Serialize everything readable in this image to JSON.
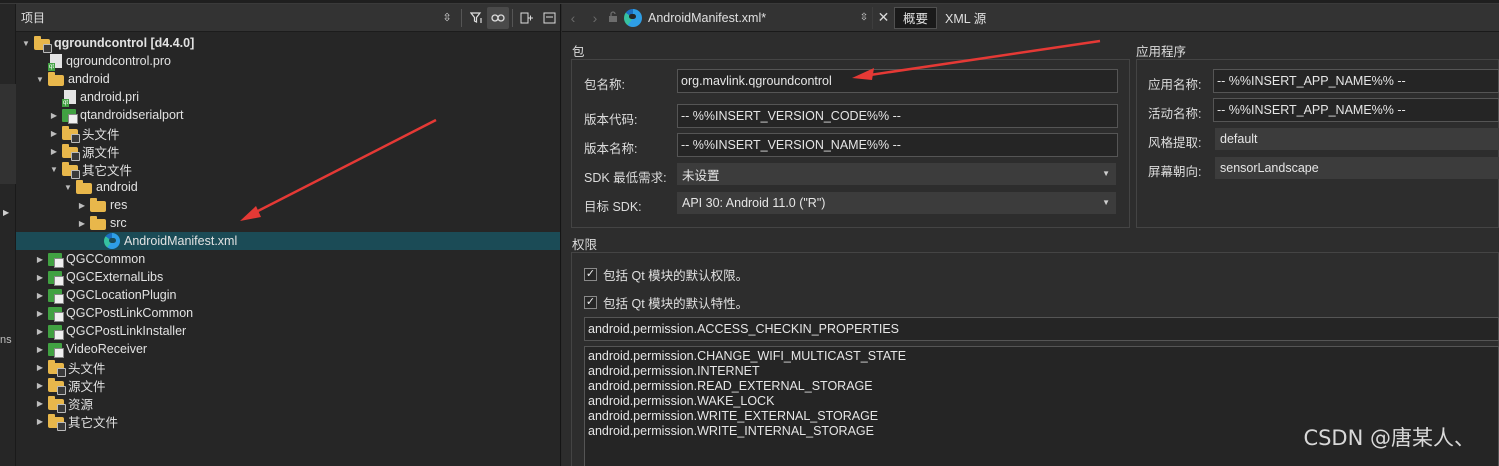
{
  "project_panel": {
    "title": "项目",
    "tree": [
      {
        "label": "qgroundcontrol [d4.4.0]",
        "bold": true,
        "indent": 0,
        "twisty": "open",
        "icon": "qt-project-root-icon"
      },
      {
        "label": "qgroundcontrol.pro",
        "indent": 1,
        "twisty": "",
        "icon": "pro-file-icon"
      },
      {
        "label": "android",
        "indent": 1,
        "twisty": "open",
        "icon": "folder-icon"
      },
      {
        "label": "android.pri",
        "indent": 2,
        "twisty": "",
        "icon": "pri-file-icon"
      },
      {
        "label": "qtandroidserialport",
        "indent": 2,
        "twisty": "closed",
        "icon": "qt-project-icon"
      },
      {
        "label": "头文件",
        "indent": 2,
        "twisty": "closed",
        "icon": "header-folder-icon"
      },
      {
        "label": "源文件",
        "indent": 2,
        "twisty": "closed",
        "icon": "source-folder-icon"
      },
      {
        "label": "其它文件",
        "indent": 2,
        "twisty": "open",
        "icon": "other-files-folder-icon"
      },
      {
        "label": "android",
        "indent": 3,
        "twisty": "open",
        "icon": "folder-icon"
      },
      {
        "label": "res",
        "indent": 4,
        "twisty": "closed",
        "icon": "folder-icon"
      },
      {
        "label": "src",
        "indent": 4,
        "twisty": "closed",
        "icon": "folder-icon"
      },
      {
        "label": "AndroidManifest.xml",
        "indent": 5,
        "twisty": "",
        "icon": "edge-browser-icon",
        "selected": true
      },
      {
        "label": "QGCCommon",
        "indent": 1,
        "twisty": "closed",
        "icon": "qt-project-icon"
      },
      {
        "label": "QGCExternalLibs",
        "indent": 1,
        "twisty": "closed",
        "icon": "qt-project-icon"
      },
      {
        "label": "QGCLocationPlugin",
        "indent": 1,
        "twisty": "closed",
        "icon": "qt-project-icon"
      },
      {
        "label": "QGCPostLinkCommon",
        "indent": 1,
        "twisty": "closed",
        "icon": "qt-project-icon"
      },
      {
        "label": "QGCPostLinkInstaller",
        "indent": 1,
        "twisty": "closed",
        "icon": "qt-project-icon"
      },
      {
        "label": "VideoReceiver",
        "indent": 1,
        "twisty": "closed",
        "icon": "qt-project-icon"
      },
      {
        "label": "头文件",
        "indent": 1,
        "twisty": "closed",
        "icon": "header-folder-icon"
      },
      {
        "label": "源文件",
        "indent": 1,
        "twisty": "closed",
        "icon": "source-folder-icon"
      },
      {
        "label": "资源",
        "indent": 1,
        "twisty": "closed",
        "icon": "resource-folder-icon"
      },
      {
        "label": "其它文件",
        "indent": 1,
        "twisty": "closed",
        "icon": "other-files-folder-icon"
      }
    ]
  },
  "left_strip": {
    "ns_text": "ns"
  },
  "editor": {
    "document_name": "AndroidManifest.xml*",
    "tabs": [
      {
        "label": "概要",
        "active": true
      },
      {
        "label": "XML 源",
        "active": false
      }
    ],
    "package_group": {
      "title": "包",
      "package_name_label": "包名称:",
      "package_name_value": "org.mavlink.qgroundcontrol",
      "version_code_label": "版本代码:",
      "version_code_value": "-- %%INSERT_VERSION_CODE%% --",
      "version_name_label": "版本名称:",
      "version_name_value": "-- %%INSERT_VERSION_NAME%% --",
      "min_sdk_label": "SDK 最低需求:",
      "min_sdk_value": "未设置",
      "target_sdk_label": "目标 SDK:",
      "target_sdk_value": "API 30: Android 11.0 (\"R\")"
    },
    "application_group": {
      "title": "应用程序",
      "app_name_label": "应用名称:",
      "app_name_value": "-- %%INSERT_APP_NAME%% --",
      "activity_name_label": "活动名称:",
      "activity_name_value": "-- %%INSERT_APP_NAME%% --",
      "style_label": "风格提取:",
      "style_value": "default",
      "orientation_label": "屏幕朝向:",
      "orientation_value": "sensorLandscape"
    },
    "permissions_group": {
      "title": "权限",
      "include_qt_permissions": "包括 Qt 模块的默认权限。",
      "include_qt_features": "包括 Qt 模块的默认特性。",
      "permission_input": "android.permission.ACCESS_CHECKIN_PROPERTIES",
      "permissions": [
        "android.permission.CHANGE_WIFI_MULTICAST_STATE",
        "android.permission.INTERNET",
        "android.permission.READ_EXTERNAL_STORAGE",
        "android.permission.WAKE_LOCK",
        "android.permission.WRITE_EXTERNAL_STORAGE",
        "android.permission.WRITE_INTERNAL_STORAGE"
      ]
    }
  },
  "watermark": "CSDN @唐某人、",
  "colors": {
    "selection": "#1b4b56",
    "arrow": "#e53935",
    "folder": "#e8b74b",
    "qt_green": "#41a142"
  }
}
